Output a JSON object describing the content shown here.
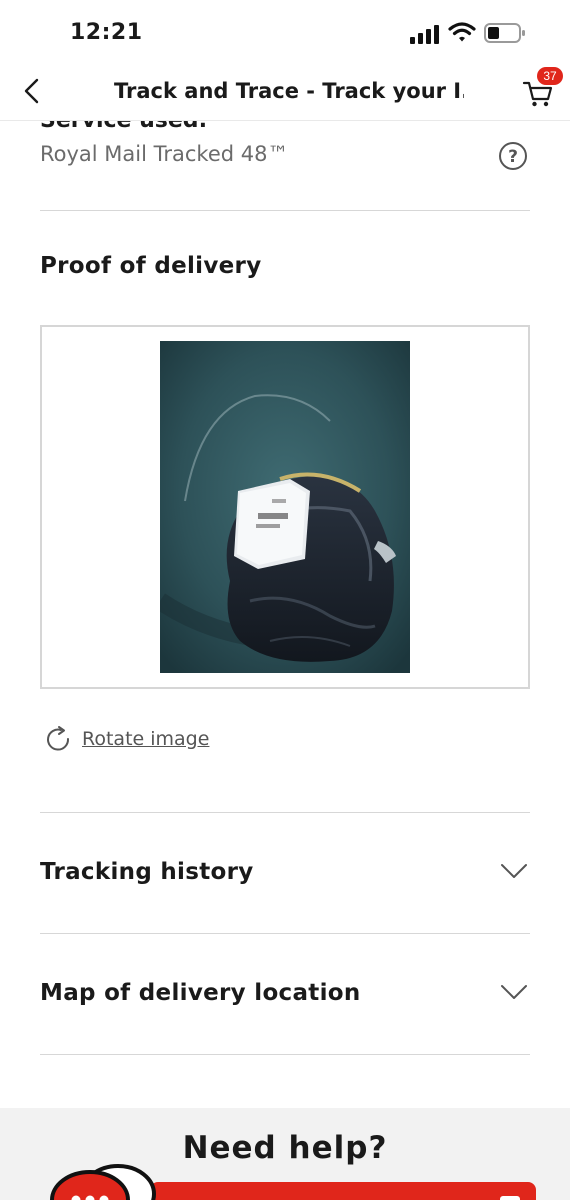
{
  "status_bar": {
    "time": "12:21"
  },
  "header": {
    "title": "Track and Trace - Track your I...",
    "cart_count": "37",
    "accent_color": "#e0261b"
  },
  "service": {
    "label_partial": "Service used:",
    "value": "Royal Mail Tracked 48™"
  },
  "proof_of_delivery": {
    "heading": "Proof of delivery",
    "rotate_label": "Rotate image"
  },
  "sections": {
    "tracking_history": "Tracking history",
    "map_location": "Map of delivery location"
  },
  "help": {
    "title": "Need help?"
  },
  "icons": [
    "back-chevron-icon",
    "cart-icon",
    "help-question-icon",
    "rotate-icon",
    "chevron-down-icon",
    "chat-bubble-icon"
  ]
}
